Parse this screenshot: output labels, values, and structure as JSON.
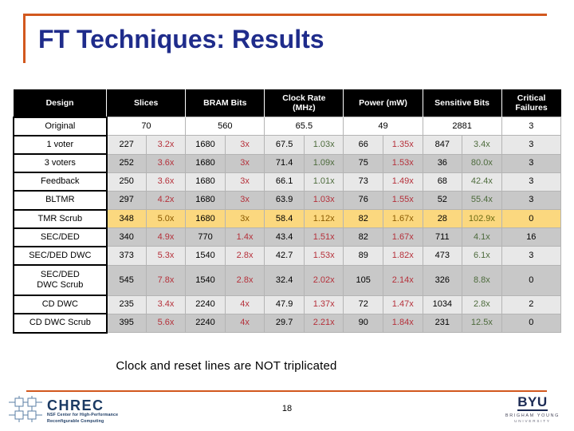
{
  "slide": {
    "title": "FT Techniques: Results",
    "caption": "Clock and reset lines are NOT triplicated",
    "page_number": "18",
    "accent_color": "#D2581E",
    "title_color": "#1F2C8B",
    "highlight_color": "#FBD87F",
    "bad_color": "#B5303A",
    "good_color": "#4D6B3C"
  },
  "table": {
    "headers": [
      "Design",
      "Slices",
      "BRAM Bits",
      "Clock Rate (MHz)",
      "Power (mW)",
      "Sensitive Bits",
      "Critical Failures"
    ],
    "header_lines": {
      "design": "Design",
      "slices": "Slices",
      "bram": "BRAM Bits",
      "clock_l1": "Clock Rate",
      "clock_l2": "(MHz)",
      "power": "Power (mW)",
      "sensitive": "Sensitive Bits",
      "critical_l1": "Critical",
      "critical_l2": "Failures"
    },
    "rows": [
      {
        "design": "Original",
        "slices": "70",
        "slices_ratio": "",
        "bram": "560",
        "bram_ratio": "",
        "clock": "65.5",
        "clock_ratio": "",
        "power": "49",
        "power_ratio": "",
        "sensitive": "2881",
        "sensitive_ratio": "",
        "critical": "3",
        "style": "original"
      },
      {
        "design": "1 voter",
        "slices": "227",
        "slices_ratio": "3.2x",
        "slices_ratio_kind": "bad",
        "bram": "1680",
        "bram_ratio": "3x",
        "bram_ratio_kind": "bad",
        "clock": "67.5",
        "clock_ratio": "1.03x",
        "clock_ratio_kind": "good",
        "power": "66",
        "power_ratio": "1.35x",
        "power_ratio_kind": "bad",
        "sensitive": "847",
        "sensitive_ratio": "3.4x",
        "sensitive_ratio_kind": "good",
        "critical": "3",
        "style": "light"
      },
      {
        "design": "3 voters",
        "slices": "252",
        "slices_ratio": "3.6x",
        "slices_ratio_kind": "bad",
        "bram": "1680",
        "bram_ratio": "3x",
        "bram_ratio_kind": "bad",
        "clock": "71.4",
        "clock_ratio": "1.09x",
        "clock_ratio_kind": "good",
        "power": "75",
        "power_ratio": "1.53x",
        "power_ratio_kind": "bad",
        "sensitive": "36",
        "sensitive_ratio": "80.0x",
        "sensitive_ratio_kind": "good",
        "critical": "3",
        "style": "dark"
      },
      {
        "design": "Feedback",
        "slices": "250",
        "slices_ratio": "3.6x",
        "slices_ratio_kind": "bad",
        "bram": "1680",
        "bram_ratio": "3x",
        "bram_ratio_kind": "bad",
        "clock": "66.1",
        "clock_ratio": "1.01x",
        "clock_ratio_kind": "good",
        "power": "73",
        "power_ratio": "1.49x",
        "power_ratio_kind": "bad",
        "sensitive": "68",
        "sensitive_ratio": "42.4x",
        "sensitive_ratio_kind": "good",
        "critical": "3",
        "style": "light"
      },
      {
        "design": "BLTMR",
        "slices": "297",
        "slices_ratio": "4.2x",
        "slices_ratio_kind": "bad",
        "bram": "1680",
        "bram_ratio": "3x",
        "bram_ratio_kind": "bad",
        "clock": "63.9",
        "clock_ratio": "1.03x",
        "clock_ratio_kind": "bad",
        "power": "76",
        "power_ratio": "1.55x",
        "power_ratio_kind": "bad",
        "sensitive": "52",
        "sensitive_ratio": "55.4x",
        "sensitive_ratio_kind": "good",
        "critical": "3",
        "style": "dark"
      },
      {
        "design": "TMR Scrub",
        "slices": "348",
        "slices_ratio": "5.0x",
        "slices_ratio_kind": "bad",
        "bram": "1680",
        "bram_ratio": "3x",
        "bram_ratio_kind": "bad",
        "clock": "58.4",
        "clock_ratio": "1.12x",
        "clock_ratio_kind": "bad",
        "power": "82",
        "power_ratio": "1.67x",
        "power_ratio_kind": "bad",
        "sensitive": "28",
        "sensitive_ratio": "102.9x",
        "sensitive_ratio_kind": "good",
        "critical": "0",
        "style": "highlight"
      },
      {
        "design": "SEC/DED",
        "slices": "340",
        "slices_ratio": "4.9x",
        "slices_ratio_kind": "bad",
        "bram": "770",
        "bram_ratio": "1.4x",
        "bram_ratio_kind": "bad",
        "clock": "43.4",
        "clock_ratio": "1.51x",
        "clock_ratio_kind": "bad",
        "power": "82",
        "power_ratio": "1.67x",
        "power_ratio_kind": "bad",
        "sensitive": "711",
        "sensitive_ratio": "4.1x",
        "sensitive_ratio_kind": "good",
        "critical": "16",
        "style": "dark"
      },
      {
        "design": "SEC/DED DWC",
        "slices": "373",
        "slices_ratio": "5.3x",
        "slices_ratio_kind": "bad",
        "bram": "1540",
        "bram_ratio": "2.8x",
        "bram_ratio_kind": "bad",
        "clock": "42.7",
        "clock_ratio": "1.53x",
        "clock_ratio_kind": "bad",
        "power": "89",
        "power_ratio": "1.82x",
        "power_ratio_kind": "bad",
        "sensitive": "473",
        "sensitive_ratio": "6.1x",
        "sensitive_ratio_kind": "good",
        "critical": "3",
        "style": "light"
      },
      {
        "design": "SEC/DED DWC Scrub",
        "design_l1": "SEC/DED",
        "design_l2": "DWC Scrub",
        "slices": "545",
        "slices_ratio": "7.8x",
        "slices_ratio_kind": "bad",
        "bram": "1540",
        "bram_ratio": "2.8x",
        "bram_ratio_kind": "bad",
        "clock": "32.4",
        "clock_ratio": "2.02x",
        "clock_ratio_kind": "bad",
        "power": "105",
        "power_ratio": "2.14x",
        "power_ratio_kind": "bad",
        "sensitive": "326",
        "sensitive_ratio": "8.8x",
        "sensitive_ratio_kind": "good",
        "critical": "0",
        "style": "dark",
        "tall": true
      },
      {
        "design": "CD DWC",
        "slices": "235",
        "slices_ratio": "3.4x",
        "slices_ratio_kind": "bad",
        "bram": "2240",
        "bram_ratio": "4x",
        "bram_ratio_kind": "bad",
        "clock": "47.9",
        "clock_ratio": "1.37x",
        "clock_ratio_kind": "bad",
        "power": "72",
        "power_ratio": "1.47x",
        "power_ratio_kind": "bad",
        "sensitive": "1034",
        "sensitive_ratio": "2.8x",
        "sensitive_ratio_kind": "good",
        "critical": "2",
        "style": "light"
      },
      {
        "design": "CD DWC Scrub",
        "slices": "395",
        "slices_ratio": "5.6x",
        "slices_ratio_kind": "bad",
        "bram": "2240",
        "bram_ratio": "4x",
        "bram_ratio_kind": "bad",
        "clock": "29.7",
        "clock_ratio": "2.21x",
        "clock_ratio_kind": "bad",
        "power": "90",
        "power_ratio": "1.84x",
        "power_ratio_kind": "bad",
        "sensitive": "231",
        "sensitive_ratio": "12.5x",
        "sensitive_ratio_kind": "good",
        "critical": "0",
        "style": "dark"
      }
    ]
  },
  "footer": {
    "chrec": {
      "name": "CHREC",
      "sub1": "NSF Center for High-Performance",
      "sub2": "Reconfigurable Computing"
    },
    "byu": {
      "name": "BYU",
      "sub1": "BRIGHAM YOUNG",
      "sub2": "UNIVERSITY"
    }
  }
}
